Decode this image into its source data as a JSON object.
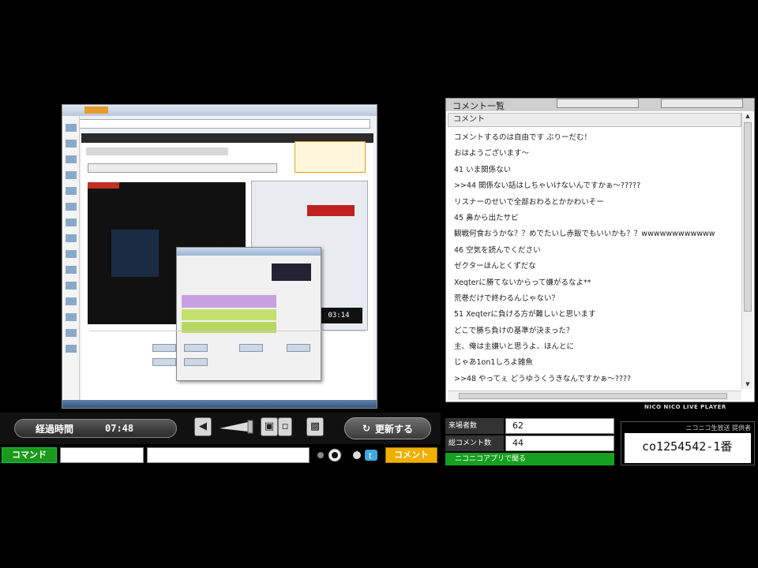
{
  "stream_capture": {
    "inner_time": "03:14"
  },
  "player_controls": {
    "elapsed_label": "経過時間",
    "elapsed_time": "07:48",
    "volume_icon": "speaker-icon",
    "reload_label": "更新する",
    "command_button": "コマンド",
    "comment_button": "コメント",
    "comment_input_value": ""
  },
  "comment_panel": {
    "title": "コメント一覧",
    "column_header": "コメント",
    "comments": [
      "コメントするのは自由です ぶりーだむ！",
      "おはようございます〜",
      "41 いま関係ない",
      ">>44 関係ない話はしちゃいけないんですかぁ〜?????",
      "リスナーのせいで全部おわるとかかわいそー",
      "45 鼻から出たサビ",
      "観戦何食おうかな？？めでたいし赤飯でもいいかも？？wwwwwwwwwwww",
      "46 空気を読んでください",
      "ゼクターほんとくずだな",
      "Xeqterに勝てないからって嫌がるなよ**",
      "荒巻だけで終わるんじゃない？",
      "51 Xeqterに負ける方が難しいと思います",
      "どこで勝ち負けの基準が決まった？",
      "主、俺は主嫌いと思うよ、ほんとに",
      "じゃあ1on1しろよ雑魚",
      ">>48 やってぇ どうゆうくうきなんですかぁ〜????"
    ],
    "brand": "NICO NICO LIVE PLAYER"
  },
  "stats": {
    "viewers_label": "来場者数",
    "viewers_value": "62",
    "comments_label": "総コメント数",
    "comments_value": "44",
    "app_link": "ニコニコアプリで聞る",
    "community_caption": "ニコニコ生放送 提供者",
    "community_id": "co1254542-1番"
  }
}
